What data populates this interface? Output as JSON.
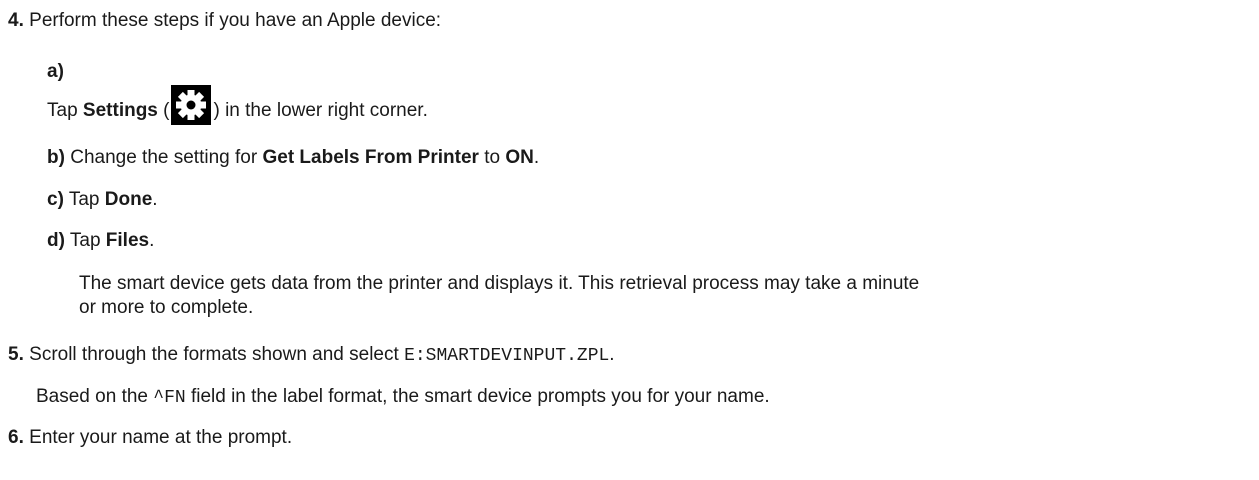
{
  "steps": [
    {
      "num": "4.",
      "text": "Perform these steps if you have an Apple device:"
    },
    {
      "num": "5.",
      "text_pre": "Scroll through the formats shown and select ",
      "code": "E:SMARTDEVINPUT.ZPL",
      "text_post": "."
    },
    {
      "num": "6.",
      "text": "Enter your name at the prompt."
    }
  ],
  "substeps": {
    "a": {
      "letter": "a)",
      "pre": "Tap ",
      "bold": "Settings",
      "paren_open": " (",
      "paren_close": ") in the lower right corner.",
      "icon": "gear-icon"
    },
    "b": {
      "letter": "b)",
      "pre": "Change the setting for ",
      "bold1": "Get Labels From Printer",
      "mid": " to ",
      "bold2": "ON",
      "post": "."
    },
    "c": {
      "letter": "c)",
      "pre": "Tap ",
      "bold": "Done",
      "post": "."
    },
    "d": {
      "letter": "d)",
      "pre": "Tap ",
      "bold": "Files",
      "post": "."
    }
  },
  "step4_note": {
    "line1": "The smart device gets data from the printer and displays it. This retrieval process may take a minute",
    "line2": "or more to complete."
  },
  "step5_note": {
    "pre": "Based on the ",
    "code": "^FN",
    "post": " field in the label format, the smart device prompts you for your name."
  }
}
